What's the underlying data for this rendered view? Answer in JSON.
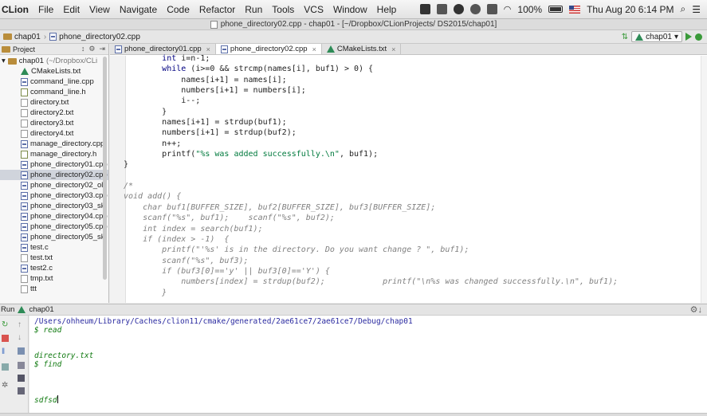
{
  "menubar": {
    "app_name": "CLion",
    "items": [
      "File",
      "Edit",
      "View",
      "Navigate",
      "Code",
      "Refactor",
      "Run",
      "Tools",
      "VCS",
      "Window",
      "Help"
    ],
    "battery": "100%",
    "clock": "Thu Aug 20  6:14 PM"
  },
  "titlebar": {
    "title": "phone_directory02.cpp - chap01 - [~/Dropbox/CLionProjects/ DS2015/chap01]"
  },
  "navbar": {
    "crumbs": [
      "chap01",
      "phone_directory02.cpp"
    ],
    "run_config": "chap01"
  },
  "project_panel": {
    "title": "Project",
    "root": "chap01",
    "root_path": "(~/Dropbox/CLi",
    "files": [
      {
        "name": "CMakeLists.txt",
        "icon": "cmake-icon"
      },
      {
        "name": "command_line.cpp",
        "icon": "cpp-file-icon"
      },
      {
        "name": "command_line.h",
        "icon": "header-file-icon"
      },
      {
        "name": "directory.txt",
        "icon": "text-file-icon"
      },
      {
        "name": "directory2.txt",
        "icon": "text-file-icon"
      },
      {
        "name": "directory3.txt",
        "icon": "text-file-icon"
      },
      {
        "name": "directory4.txt",
        "icon": "text-file-icon"
      },
      {
        "name": "manage_directory.cpp",
        "icon": "cpp-file-icon"
      },
      {
        "name": "manage_directory.h",
        "icon": "header-file-icon"
      },
      {
        "name": "phone_directory01.cpp",
        "icon": "cpp-file-icon"
      },
      {
        "name": "phone_directory02.cpp",
        "icon": "cpp-file-icon",
        "selected": true
      },
      {
        "name": "phone_directory02_ol",
        "icon": "cpp-file-icon"
      },
      {
        "name": "phone_directory03.cpp",
        "icon": "cpp-file-icon"
      },
      {
        "name": "phone_directory03_sk",
        "icon": "cpp-file-icon"
      },
      {
        "name": "phone_directory04.cpp",
        "icon": "cpp-file-icon"
      },
      {
        "name": "phone_directory05.cpp",
        "icon": "cpp-file-icon"
      },
      {
        "name": "phone_directory05_sk",
        "icon": "cpp-file-icon"
      },
      {
        "name": "test.c",
        "icon": "c-file-icon"
      },
      {
        "name": "test.txt",
        "icon": "text-file-icon"
      },
      {
        "name": "test2.c",
        "icon": "c-file-icon"
      },
      {
        "name": "tmp.txt",
        "icon": "text-file-icon"
      },
      {
        "name": "ttt",
        "icon": "text-file-icon"
      }
    ]
  },
  "editor": {
    "tabs": [
      {
        "label": "phone_directory01.cpp",
        "active": false
      },
      {
        "label": "phone_directory02.cpp",
        "active": true
      },
      {
        "label": "CMakeLists.txt",
        "active": false
      }
    ],
    "code_lines": [
      "        int i=n-1;",
      "        while (i>=0 && strcmp(names[i], buf1) > 0) {",
      "            names[i+1] = names[i];",
      "            numbers[i+1] = numbers[i];",
      "            i--;",
      "        }",
      "        names[i+1] = strdup(buf1);",
      "        numbers[i+1] = strdup(buf2);",
      "        n++;",
      "        printf(\"%s was added successfully.\\n\", buf1);",
      "}",
      "",
      "/*",
      "void add() {",
      "    char buf1[BUFFER_SIZE], buf2[BUFFER_SIZE], buf3[BUFFER_SIZE];",
      "    scanf(\"%s\", buf1);    scanf(\"%s\", buf2);",
      "    int index = search(buf1);",
      "    if (index > -1)  {",
      "        printf(\"'%s' is in the directory. Do you want change ? \", buf1);",
      "        scanf(\"%s\", buf3);",
      "        if (buf3[0]=='y' || buf3[0]=='Y') {",
      "            numbers[index] = strdup(buf2);            printf(\"\\n%s was changed successfully.\\n\", buf1);",
      "        }"
    ]
  },
  "run_panel": {
    "label": "Run",
    "config": "chap01",
    "output": [
      {
        "text": "/Users/ohheum/Library/Caches/clion11/cmake/generated/2ae61ce7/2ae61ce7/Debug/chap01",
        "kind": "path"
      },
      {
        "text": "$ read",
        "kind": "input"
      },
      {
        "text": "",
        "kind": "plain"
      },
      {
        "text": "",
        "kind": "plain"
      },
      {
        "text": "directory.txt",
        "kind": "input"
      },
      {
        "text": "$ find",
        "kind": "input"
      },
      {
        "text": "",
        "kind": "plain"
      },
      {
        "text": "",
        "kind": "plain"
      },
      {
        "text": "",
        "kind": "plain"
      },
      {
        "text": "sdfsd",
        "kind": "input",
        "cursor": true
      }
    ]
  }
}
